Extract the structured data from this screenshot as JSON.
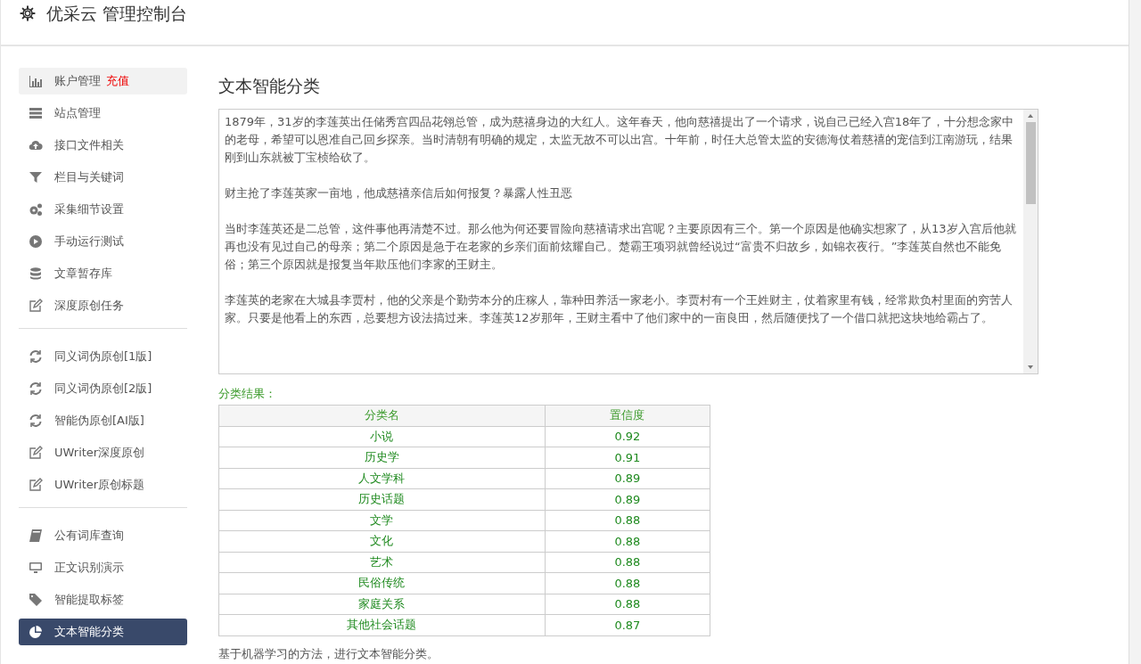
{
  "header": {
    "title": "优采云 管理控制台"
  },
  "sidebar": {
    "groups": [
      {
        "items": [
          {
            "label": "账户管理",
            "badge": "充值",
            "selected": false
          },
          {
            "label": "站点管理",
            "selected": false
          },
          {
            "label": "接口文件相关",
            "selected": false
          },
          {
            "label": "栏目与关键词",
            "selected": false
          },
          {
            "label": "采集细节设置",
            "selected": false
          },
          {
            "label": "手动运行测试",
            "selected": false
          },
          {
            "label": "文章暂存库",
            "selected": false
          },
          {
            "label": "深度原创任务",
            "selected": false
          }
        ]
      },
      {
        "items": [
          {
            "label": "同义词伪原创[1版]",
            "selected": false
          },
          {
            "label": "同义词伪原创[2版]",
            "selected": false
          },
          {
            "label": "智能伪原创[AI版]",
            "selected": false
          },
          {
            "label": "UWriter深度原创",
            "selected": false
          },
          {
            "label": "UWriter原创标题",
            "selected": false
          }
        ]
      },
      {
        "items": [
          {
            "label": "公有词库查询",
            "selected": false
          },
          {
            "label": "正文识别演示",
            "selected": false
          },
          {
            "label": "智能提取标签",
            "selected": false
          },
          {
            "label": "文本智能分类",
            "selected": true
          }
        ]
      }
    ]
  },
  "main": {
    "title": "文本智能分类",
    "text_area": {
      "paragraphs": [
        "1879年，31岁的李莲英出任储秀宫四品花翎总管，成为慈禧身边的大红人。这年春天，他向慈禧提出了一个请求，说自己已经入宫18年了，十分想念家中的老母，希望可以恩准自己回乡探亲。当时清朝有明确的规定，太监无故不可以出宫。十年前，时任大总管太监的安德海仗着慈禧的宠信到江南游玩，结果刚到山东就被丁宝桢给砍了。",
        "财主抢了李莲英家一亩地，他成慈禧亲信后如何报复？暴露人性丑恶",
        "当时李莲英还是二总管，这件事他再清楚不过。那么他为何还要冒险向慈禧请求出宫呢？主要原因有三个。第一个原因是他确实想家了，从13岁入宫后他就再也没有见过自己的母亲；第二个原因是急于在老家的乡亲们面前炫耀自己。楚霸王项羽就曾经说过“富贵不归故乡，如锦衣夜行。”李莲英自然也不能免俗；第三个原因就是报复当年欺压他们李家的王财主。",
        "李莲英的老家在大城县李贾村，他的父亲是个勤劳本分的庄稼人，靠种田养活一家老小。李贾村有一个王姓财主，仗着家里有钱，经常欺负村里面的穷苦人家。只要是他看上的东西，总要想方设法搞过来。李莲英12岁那年，王财主看中了他们家中的一亩良田，然后随便找了一个借口就把这块地给霸占了。"
      ]
    },
    "result_label": "分类结果：",
    "table": {
      "columns": [
        "分类名",
        "置信度"
      ],
      "rows": [
        [
          "小说",
          "0.92"
        ],
        [
          "历史学",
          "0.91"
        ],
        [
          "人文学科",
          "0.89"
        ],
        [
          "历史话题",
          "0.89"
        ],
        [
          "文学",
          "0.88"
        ],
        [
          "文化",
          "0.88"
        ],
        [
          "艺术",
          "0.88"
        ],
        [
          "民俗传统",
          "0.88"
        ],
        [
          "家庭关系",
          "0.88"
        ],
        [
          "其他社会话题",
          "0.87"
        ]
      ]
    },
    "note": "基于机器学习的方法，进行文本智能分类。"
  }
}
